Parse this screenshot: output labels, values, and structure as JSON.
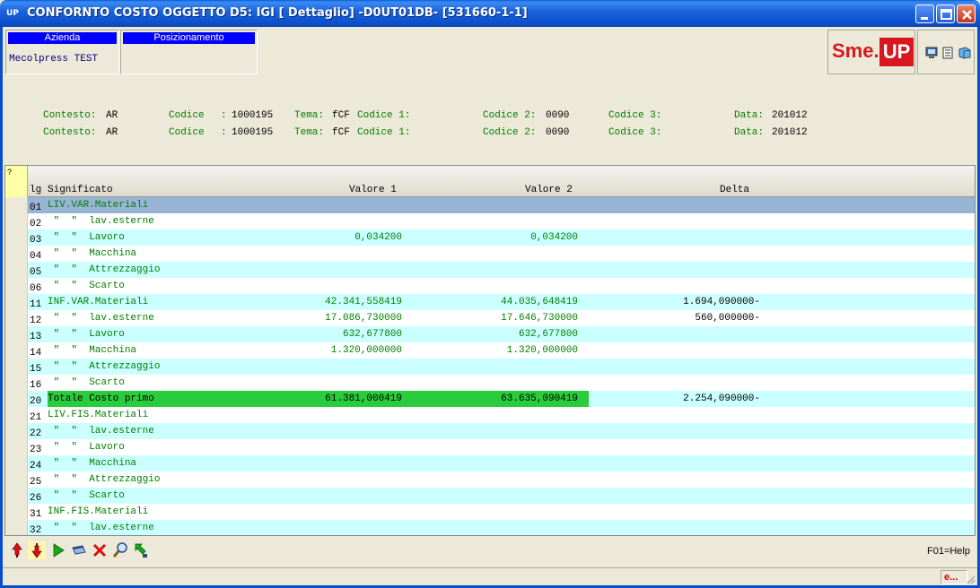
{
  "window": {
    "title": "CONFORNTO COSTO OGGETTO D5: IGI [ Dettaglio] -D0UT01DB- [531660-1-1]",
    "app_icon_label": "UP"
  },
  "header": {
    "azienda_label": "Azienda",
    "azienda_value": "Mecolpress TEST",
    "posizionamento_label": "Posizionamento",
    "posizionamento_value": "",
    "logo_text_left": "Sme.",
    "logo_text_right": "UP"
  },
  "context_lines": [
    {
      "contesto_label": "Contesto:",
      "contesto_value": "AR",
      "codice_label": "Codice",
      "codice_sep": ":",
      "codice_value": "1000195",
      "tema_label": "Tema:",
      "tema_value": "fCF",
      "codice1_label": "Codice 1:",
      "codice1_value": "",
      "codice2_label": "Codice 2:",
      "codice2_value": "0090",
      "codice3_label": "Codice 3:",
      "codice3_value": "",
      "data_label": "Data:",
      "data_value": "201012"
    },
    {
      "contesto_label": "Contesto:",
      "contesto_value": "AR",
      "codice_label": "Codice",
      "codice_sep": ":",
      "codice_value": "1000195",
      "tema_label": "Tema:",
      "tema_value": "fCF",
      "codice1_label": "Codice 1:",
      "codice1_value": "",
      "codice2_label": "Codice 2:",
      "codice2_value": "0090",
      "codice3_label": "Codice 3:",
      "codice3_value": "",
      "data_label": "Data:",
      "data_value": "201012"
    }
  ],
  "grid": {
    "corner_label": "?",
    "columns": {
      "lv": "lg",
      "significato": "Significato",
      "valore1": "Valore 1",
      "valore2": "Valore 2",
      "delta": "Delta"
    },
    "rows": [
      {
        "lv": "01",
        "sig": "LIV.VAR.Materiali",
        "v1": "",
        "v2": "",
        "delta": ""
      },
      {
        "lv": "02",
        "sig": " \"  \"  lav.esterne",
        "v1": "",
        "v2": "",
        "delta": ""
      },
      {
        "lv": "03",
        "sig": " \"  \"  Lavoro",
        "v1": "0,034200",
        "v2": "0,034200",
        "delta": ""
      },
      {
        "lv": "04",
        "sig": " \"  \"  Macchina",
        "v1": "",
        "v2": "",
        "delta": ""
      },
      {
        "lv": "05",
        "sig": " \"  \"  Attrezzaggio",
        "v1": "",
        "v2": "",
        "delta": ""
      },
      {
        "lv": "06",
        "sig": " \"  \"  Scarto",
        "v1": "",
        "v2": "",
        "delta": ""
      },
      {
        "lv": "11",
        "sig": "INF.VAR.Materiali",
        "v1": "42.341,558419",
        "v2": "44.035,648419",
        "delta": "1.694,090000-"
      },
      {
        "lv": "12",
        "sig": " \"  \"  lav.esterne",
        "v1": "17.086,730000",
        "v2": "17.646,730000",
        "delta": "560,000000-"
      },
      {
        "lv": "13",
        "sig": " \"  \"  Lavoro",
        "v1": "632,677800",
        "v2": "632,677800",
        "delta": ""
      },
      {
        "lv": "14",
        "sig": " \"  \"  Macchina",
        "v1": "1.320,000000",
        "v2": "1.320,000000",
        "delta": ""
      },
      {
        "lv": "15",
        "sig": " \"  \"  Attrezzaggio",
        "v1": "",
        "v2": "",
        "delta": ""
      },
      {
        "lv": "16",
        "sig": " \"  \"  Scarto",
        "v1": "",
        "v2": "",
        "delta": ""
      },
      {
        "lv": "20",
        "sig": "Totale Costo primo",
        "v1": "61.381,000419",
        "v2": "63.635,090419",
        "delta": "2.254,090000-"
      },
      {
        "lv": "21",
        "sig": "LIV.FIS.Materiali",
        "v1": "",
        "v2": "",
        "delta": ""
      },
      {
        "lv": "22",
        "sig": " \"  \"  lav.esterne",
        "v1": "",
        "v2": "",
        "delta": ""
      },
      {
        "lv": "23",
        "sig": " \"  \"  Lavoro",
        "v1": "",
        "v2": "",
        "delta": ""
      },
      {
        "lv": "24",
        "sig": " \"  \"  Macchina",
        "v1": "",
        "v2": "",
        "delta": ""
      },
      {
        "lv": "25",
        "sig": " \"  \"  Attrezzaggio",
        "v1": "",
        "v2": "",
        "delta": ""
      },
      {
        "lv": "26",
        "sig": " \"  \"  Scarto",
        "v1": "",
        "v2": "",
        "delta": ""
      },
      {
        "lv": "31",
        "sig": "INF.FIS.Materiali",
        "v1": "",
        "v2": "",
        "delta": ""
      },
      {
        "lv": "32",
        "sig": " \"  \"  lav.esterne",
        "v1": "",
        "v2": "",
        "delta": ""
      }
    ]
  },
  "toolbar": {
    "icons": [
      "arrow-up-icon",
      "arrow-down-icon",
      "play-icon",
      "window-icon",
      "cancel-icon",
      "search-icon",
      "refresh-icon"
    ],
    "help_text": "F01=Help"
  },
  "status": {
    "indicator": "e..."
  },
  "colors": {
    "row_alt": "#ccffff",
    "row_selected": "#98b4d4",
    "total_highlight": "#28cc3c",
    "label_green": "#008000",
    "header_blue": "#0000ff"
  }
}
